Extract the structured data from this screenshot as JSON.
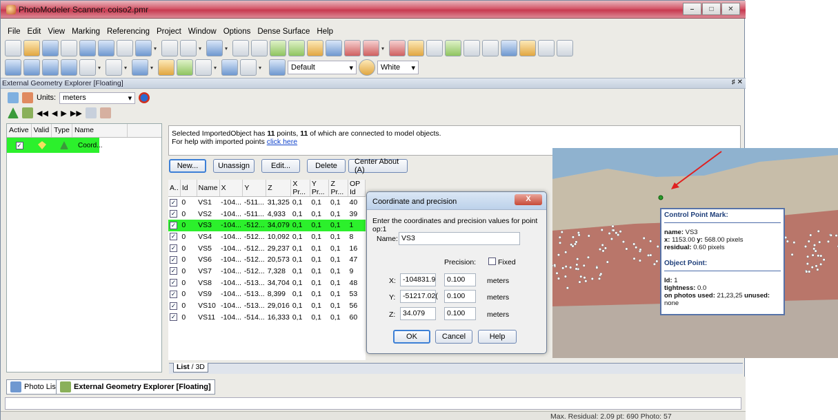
{
  "window": {
    "title": "PhotoModeler Scanner: coiso2.pmr"
  },
  "menu": [
    "File",
    "Edit",
    "View",
    "Marking",
    "Referencing",
    "Project",
    "Window",
    "Options",
    "Dense Surface",
    "Help"
  ],
  "toolbar": {
    "style_value": "Default",
    "color_value": "White"
  },
  "panel": {
    "title": "External Geometry Explorer [Floating]",
    "units_label": "Units:",
    "units_value": "meters"
  },
  "left_table": {
    "headers": [
      "Active",
      "Valid",
      "Type",
      "Name"
    ],
    "row": {
      "name": "Coord..."
    }
  },
  "info": {
    "prefix": "Selected ImportedObject has",
    "points": "11",
    "mid": "points,",
    "connected": "11",
    "suffix": "of which are connected to model objects.",
    "help_text": "For help with imported points",
    "help_link": "click here"
  },
  "buttons": {
    "new": "New...",
    "unassign": "Unassign",
    "edit": "Edit...",
    "delete": "Delete",
    "center": "Center About (A)"
  },
  "points_table": {
    "headers": [
      "A..",
      "Id",
      "Name",
      "X",
      "Y",
      "Z",
      "X Pr...",
      "Y Pr...",
      "Z Pr...",
      "OP Id"
    ],
    "rows": [
      {
        "id": "0",
        "name": "VS1",
        "x": "-104...",
        "y": "-511...",
        "z": "31,325",
        "xp": "0,1",
        "yp": "0,1",
        "zp": "0,1",
        "op": "40"
      },
      {
        "id": "0",
        "name": "VS2",
        "x": "-104...",
        "y": "-511...",
        "z": "4,933",
        "xp": "0,1",
        "yp": "0,1",
        "zp": "0,1",
        "op": "39"
      },
      {
        "id": "0",
        "name": "VS3",
        "x": "-104...",
        "y": "-512...",
        "z": "34,079",
        "xp": "0,1",
        "yp": "0,1",
        "zp": "0,1",
        "op": "1"
      },
      {
        "id": "0",
        "name": "VS4",
        "x": "-104...",
        "y": "-512...",
        "z": "10,092",
        "xp": "0,1",
        "yp": "0,1",
        "zp": "0,1",
        "op": "8"
      },
      {
        "id": "0",
        "name": "VS5",
        "x": "-104...",
        "y": "-512...",
        "z": "29,237",
        "xp": "0,1",
        "yp": "0,1",
        "zp": "0,1",
        "op": "16"
      },
      {
        "id": "0",
        "name": "VS6",
        "x": "-104...",
        "y": "-512...",
        "z": "20,573",
        "xp": "0,1",
        "yp": "0,1",
        "zp": "0,1",
        "op": "47"
      },
      {
        "id": "0",
        "name": "VS7",
        "x": "-104...",
        "y": "-512...",
        "z": "7,328",
        "xp": "0,1",
        "yp": "0,1",
        "zp": "0,1",
        "op": "9"
      },
      {
        "id": "0",
        "name": "VS8",
        "x": "-104...",
        "y": "-513...",
        "z": "34,704",
        "xp": "0,1",
        "yp": "0,1",
        "zp": "0,1",
        "op": "48"
      },
      {
        "id": "0",
        "name": "VS9",
        "x": "-104...",
        "y": "-513...",
        "z": "8,399",
        "xp": "0,1",
        "yp": "0,1",
        "zp": "0,1",
        "op": "53"
      },
      {
        "id": "0",
        "name": "VS10",
        "x": "-104...",
        "y": "-513...",
        "z": "29,016",
        "xp": "0,1",
        "yp": "0,1",
        "zp": "0,1",
        "op": "56"
      },
      {
        "id": "0",
        "name": "VS11",
        "x": "-104...",
        "y": "-514...",
        "z": "16,333",
        "xp": "0,1",
        "yp": "0,1",
        "zp": "0,1",
        "op": "60"
      }
    ],
    "selected_row": 2
  },
  "view_tabs": {
    "list": "List",
    "threed": "3D"
  },
  "dialog": {
    "title": "Coordinate and precision",
    "close": "X",
    "prompt": "Enter the coordinates and precision values for point op:1",
    "name_label": "Name:",
    "name_value": "VS3",
    "precision_label": "Precision:",
    "fixed_label": "Fixed",
    "x_label": "X:",
    "x_value": "-104831.9",
    "x_prec": "0.100",
    "y_label": "Y:",
    "y_value": "-51217.02(",
    "y_prec": "0.100",
    "z_label": "Z:",
    "z_value": "34.079",
    "z_prec": "0.100",
    "units": "meters",
    "ok": "OK",
    "cancel": "Cancel",
    "help": "Help"
  },
  "control_point": {
    "header": "Control Point Mark:",
    "name_label": "name:",
    "name_value": "VS3",
    "xy_x_label": "x:",
    "x_value": "1153.00",
    "xy_y_label": "y:",
    "y_value": "568.00 pixels",
    "residual_label": "residual:",
    "residual_value": "0.60 pixels",
    "obj_header": "Object Point:",
    "id_label": "Id:",
    "id_value": "1",
    "tight_label": "tightness:",
    "tight_value": "0.0",
    "photos_label": "on photos used:",
    "photos_value": "21,23,25",
    "unused_label": "unused:",
    "unused_value": "none"
  },
  "bottom_tabs": {
    "photo_list": "Photo List",
    "geometry": "External Geometry Explorer [Floating]"
  },
  "status": "Max. Residual: 2.09 pt: 690 Photo: 57",
  "colors": {
    "selection": "#2cf02c",
    "titlebar": "#d55a6b",
    "arrow": "#e02020"
  }
}
